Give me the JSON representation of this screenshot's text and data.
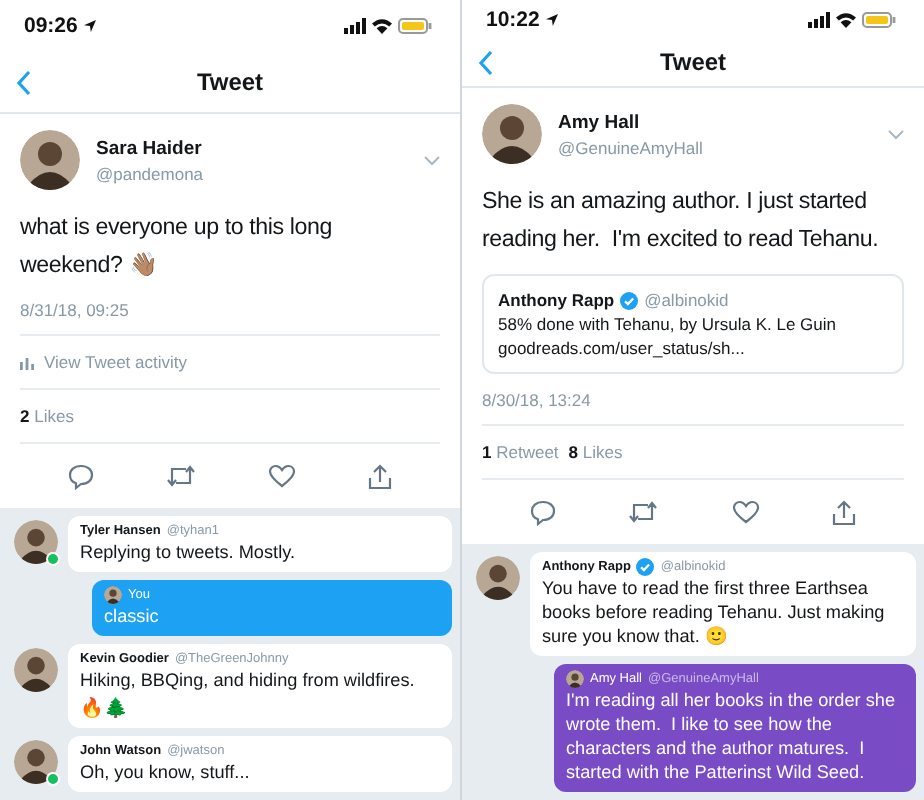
{
  "screens": [
    {
      "status_bar": {
        "time": "09:26"
      },
      "nav": {
        "title": "Tweet"
      },
      "tweet": {
        "author": "Sara Haider",
        "handle": "@pandemona",
        "text": "what is everyone up to this long weekend? 👋🏽",
        "date": "8/31/18, 09:25",
        "activity": "View Tweet activity",
        "stats": [
          {
            "count": "2",
            "label": "Likes"
          }
        ]
      },
      "replies": [
        {
          "kind": "reply",
          "author": "Tyler Hansen",
          "handle": "@tyhan1",
          "verified": false,
          "online": true,
          "text": "Replying to tweets. Mostly."
        },
        {
          "kind": "mine",
          "author": "You",
          "color": "#1da1f2",
          "text": "classic"
        },
        {
          "kind": "reply",
          "author": "Kevin Goodier",
          "handle": "@TheGreenJohnny",
          "verified": false,
          "online": false,
          "text": "Hiking, BBQing, and hiding from wildfires.",
          "reactions": "🔥🌲"
        },
        {
          "kind": "reply",
          "author": "John Watson",
          "handle": "@jwatson",
          "verified": false,
          "online": true,
          "text": "Oh, you know, stuff..."
        }
      ]
    },
    {
      "status_bar": {
        "time": "10:22"
      },
      "nav": {
        "title": "Tweet"
      },
      "tweet": {
        "author": "Amy Hall",
        "handle": "@GenuineAmyHall",
        "text": "She is an amazing author. I just started reading her.  I'm excited to read Tehanu.",
        "quote": {
          "author": "Anthony Rapp",
          "verified": true,
          "handle": "@albinokid",
          "text": "58% done with Tehanu, by Ursula K. Le Guin",
          "link": "goodreads.com/user_status/sh..."
        },
        "date": "8/30/18, 13:24",
        "stats": [
          {
            "count": "1",
            "label": "Retweet"
          },
          {
            "count": "8",
            "label": "Likes"
          }
        ]
      },
      "replies": [
        {
          "kind": "reply",
          "author": "Anthony Rapp",
          "handle": "@albinokid",
          "verified": true,
          "online": false,
          "text": "You have to read the first three Earthsea books before reading Tehanu. Just making sure you know that. 🙂"
        },
        {
          "kind": "mine",
          "author": "Amy Hall",
          "handle": "@GenuineAmyHall",
          "color": "#794bc4",
          "text": "I'm reading all her books in the order she wrote them.  I like to see how the characters and the author matures.  I started with the Patterinst Wild Seed."
        }
      ]
    }
  ]
}
